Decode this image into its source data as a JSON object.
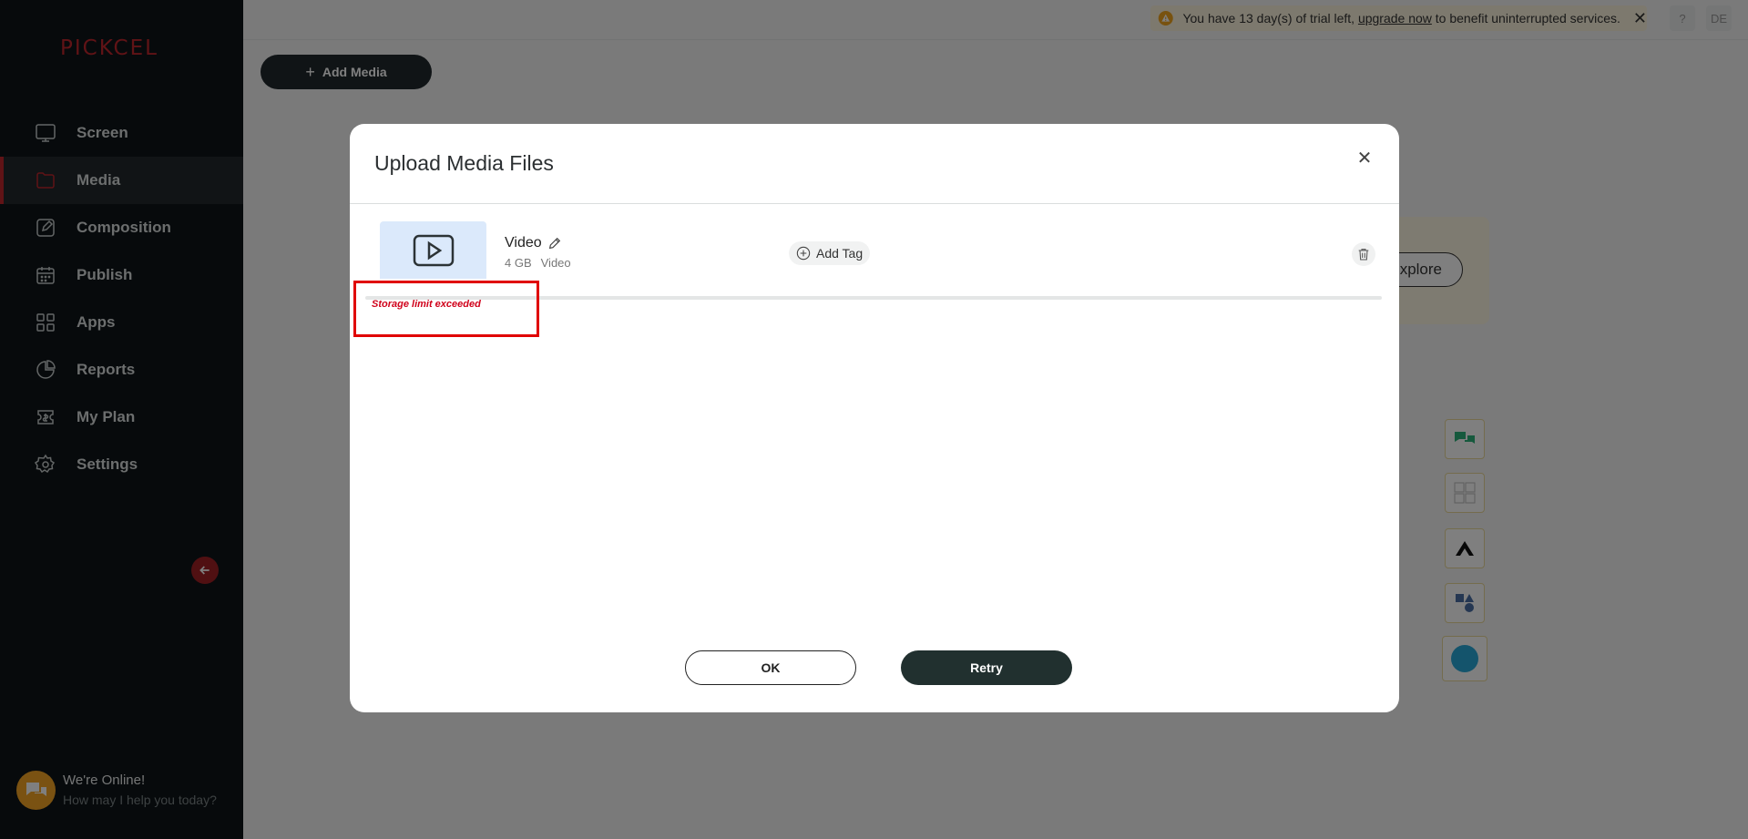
{
  "app": {
    "logo_text": "PICKCEL"
  },
  "sidebar": {
    "items": [
      {
        "label": "Screen",
        "icon": "monitor-icon"
      },
      {
        "label": "Media",
        "icon": "folder-icon",
        "active": true
      },
      {
        "label": "Composition",
        "icon": "edit-icon"
      },
      {
        "label": "Publish",
        "icon": "calendar-icon"
      },
      {
        "label": "Apps",
        "icon": "apps-grid-icon"
      },
      {
        "label": "Reports",
        "icon": "pie-chart-icon"
      },
      {
        "label": "My Plan",
        "icon": "plan-icon"
      },
      {
        "label": "Settings",
        "icon": "gear-icon"
      }
    ],
    "collapse_icon": "arrow-left-icon"
  },
  "chat": {
    "title": "We're Online!",
    "subtitle": "How may I help you today?"
  },
  "topbar": {
    "trial_prefix": "You have 13 day(s) of trial left, ",
    "trial_link": "upgrade now",
    "trial_suffix": " to benefit uninterrupted services.",
    "help_label": "?",
    "user_initials": "DE"
  },
  "toolbar": {
    "add_media_label": "Add Media"
  },
  "background": {
    "explore_label": "xplore"
  },
  "modal": {
    "title": "Upload Media Files",
    "file": {
      "name": "Video",
      "size": "4 GB",
      "type": "Video",
      "progress": 0,
      "error": "Storage limit exceeded"
    },
    "add_tag_label": "Add Tag",
    "ok_label": "OK",
    "retry_label": "Retry"
  },
  "colors": {
    "brand_red": "#c0262d",
    "sidebar_bg": "#0f1519",
    "primary_dark": "#21302f",
    "error_red": "#d0021b"
  }
}
